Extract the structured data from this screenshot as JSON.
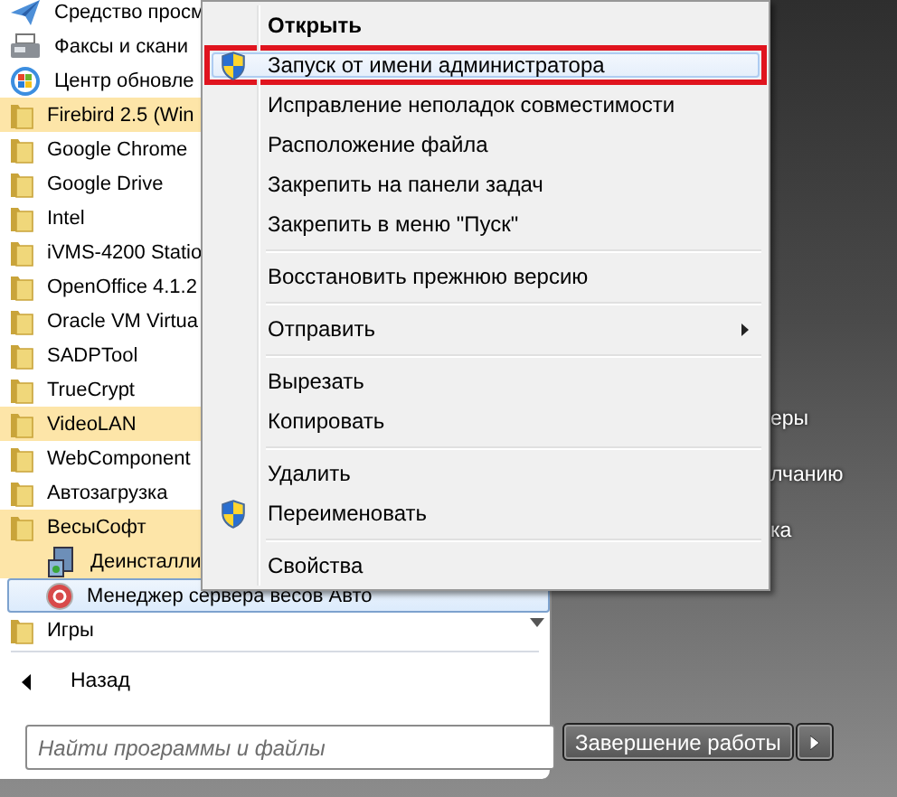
{
  "programs": [
    {
      "label": "Средство просм",
      "kind": "send",
      "new": false,
      "selected": false
    },
    {
      "label": "Факсы и скани",
      "kind": "fax",
      "new": false,
      "selected": false
    },
    {
      "label": "Центр обновле",
      "kind": "update",
      "new": false,
      "selected": false
    },
    {
      "label": "Firebird 2.5 (Win",
      "kind": "folder",
      "new": true,
      "selected": false
    },
    {
      "label": "Google Chrome",
      "kind": "folder",
      "new": false,
      "selected": false
    },
    {
      "label": "Google Drive",
      "kind": "folder",
      "new": false,
      "selected": false
    },
    {
      "label": "Intel",
      "kind": "folder",
      "new": false,
      "selected": false
    },
    {
      "label": "iVMS-4200 Statio",
      "kind": "folder",
      "new": false,
      "selected": false
    },
    {
      "label": "OpenOffice 4.1.2",
      "kind": "folder",
      "new": false,
      "selected": false
    },
    {
      "label": "Oracle VM Virtua",
      "kind": "folder",
      "new": false,
      "selected": false
    },
    {
      "label": "SADPTool",
      "kind": "folder",
      "new": false,
      "selected": false
    },
    {
      "label": "TrueCrypt",
      "kind": "folder",
      "new": false,
      "selected": false
    },
    {
      "label": "VideoLAN",
      "kind": "folder",
      "new": true,
      "selected": false
    },
    {
      "label": "WebComponent",
      "kind": "folder",
      "new": false,
      "selected": false
    },
    {
      "label": "Автозагрузка",
      "kind": "folder",
      "new": false,
      "selected": false
    },
    {
      "label": "ВесыСофт",
      "kind": "folder",
      "new": true,
      "selected": false,
      "children": [
        {
          "label": "Деинсталли",
          "kind": "setup",
          "new": true,
          "selected": false
        },
        {
          "label": "Менеджер сервера весов Авто",
          "kind": "app",
          "new": false,
          "selected": true
        }
      ]
    },
    {
      "label": "Игры",
      "kind": "folder",
      "new": false,
      "selected": false
    }
  ],
  "back": {
    "label": "Назад"
  },
  "search": {
    "placeholder": "Найти программы и файлы"
  },
  "right_panel": {
    "links": [
      "еры",
      "лчанию",
      "ка"
    ]
  },
  "shutdown": {
    "label": "Завершение работы"
  },
  "context_menu": [
    {
      "kind": "default",
      "label": "Открыть",
      "selected": false,
      "marked": false
    },
    {
      "kind": "item",
      "label": "Запуск от имени администратора",
      "shield": true,
      "selected": true,
      "marked": true
    },
    {
      "kind": "item",
      "label": "Исправление неполадок совместимости",
      "selected": false,
      "marked": false
    },
    {
      "kind": "item",
      "label": "Расположение файла",
      "selected": false,
      "marked": false
    },
    {
      "kind": "item",
      "label": "Закрепить на панели задач",
      "selected": false,
      "marked": false
    },
    {
      "kind": "item",
      "label": "Закрепить в меню \"Пуск\"",
      "selected": false,
      "marked": false
    },
    {
      "kind": "separator"
    },
    {
      "kind": "item",
      "label": "Восстановить прежнюю версию",
      "selected": false,
      "marked": false
    },
    {
      "kind": "separator"
    },
    {
      "kind": "item",
      "label": "Отправить",
      "submenu": true,
      "selected": false,
      "marked": false
    },
    {
      "kind": "separator"
    },
    {
      "kind": "item",
      "label": "Вырезать",
      "selected": false,
      "marked": false
    },
    {
      "kind": "item",
      "label": "Копировать",
      "selected": false,
      "marked": false
    },
    {
      "kind": "separator"
    },
    {
      "kind": "item",
      "label": "Удалить",
      "selected": false,
      "marked": false
    },
    {
      "kind": "item",
      "label": "Переименовать",
      "shield": true,
      "selected": false,
      "marked": false
    },
    {
      "kind": "separator"
    },
    {
      "kind": "item",
      "label": "Свойства",
      "selected": false,
      "marked": false
    }
  ]
}
